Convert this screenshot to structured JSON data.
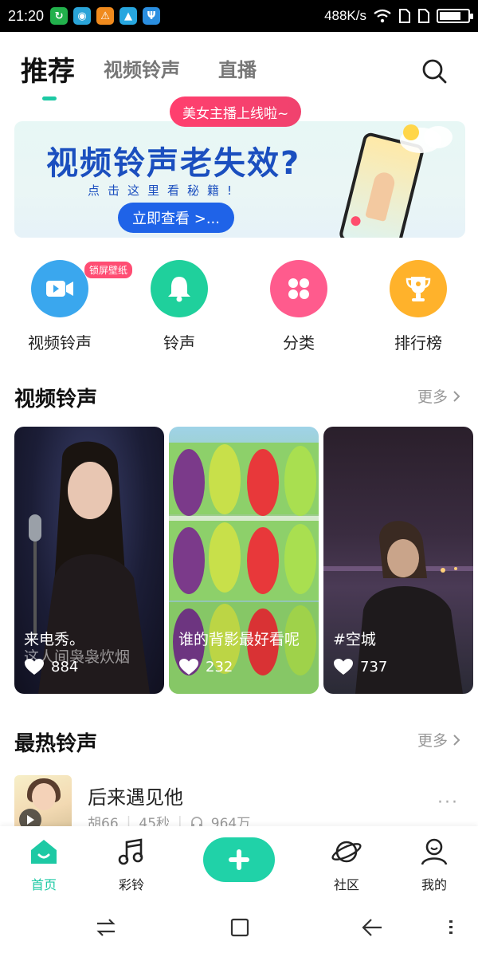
{
  "status_bar": {
    "time": "21:20",
    "network_speed": "488K/s",
    "battery_percent": 75,
    "notification_icons": [
      "circle-arrow-icon",
      "chat-bubble-icon",
      "warning-icon",
      "game-controller-icon",
      "usb-icon"
    ]
  },
  "header": {
    "tabs": [
      {
        "label": "推荐",
        "active": true
      },
      {
        "label": "视频铃声",
        "active": false
      },
      {
        "label": "直播",
        "active": false
      }
    ],
    "live_pill": "美女主播上线啦~"
  },
  "banner": {
    "title": "视频铃声老失效?",
    "subtitle": "点击这里看秘籍!",
    "button": "立即查看 >..."
  },
  "quick_actions": [
    {
      "label": "视频铃声",
      "icon": "video-camera-icon",
      "color": "#3aa7ee",
      "badge": "锁屏壁纸"
    },
    {
      "label": "铃声",
      "icon": "bell-icon",
      "color": "#1fd09c"
    },
    {
      "label": "分类",
      "icon": "grid-dots-icon",
      "color": "#ff5b8d"
    },
    {
      "label": "排行榜",
      "icon": "trophy-icon",
      "color": "#ffb22b"
    }
  ],
  "video_section": {
    "title": "视频铃声",
    "more": "更多",
    "cards": [
      {
        "title": "来电秀。",
        "caption": "这人间袅袅炊烟",
        "likes": "884"
      },
      {
        "title": "谁的背影最好看呢",
        "likes": "232"
      },
      {
        "title": "#空城",
        "likes": "737"
      }
    ]
  },
  "hot_section": {
    "title": "最热铃声",
    "more": "更多",
    "items": [
      {
        "title": "后来遇见他",
        "artist": "胡66",
        "duration": "45秒",
        "plays": "964万",
        "more": "···"
      }
    ]
  },
  "bottom_nav": {
    "items": [
      {
        "label": "首页",
        "icon": "home-icon",
        "active": true
      },
      {
        "label": "彩铃",
        "icon": "music-note-icon",
        "active": false
      },
      {
        "label": "社区",
        "icon": "planet-icon",
        "active": false
      },
      {
        "label": "我的",
        "icon": "user-icon",
        "active": false
      }
    ]
  },
  "colors": {
    "accent": "#1dc9a4",
    "banner_blue": "#1f63e8",
    "pink": "#ff4d73"
  }
}
